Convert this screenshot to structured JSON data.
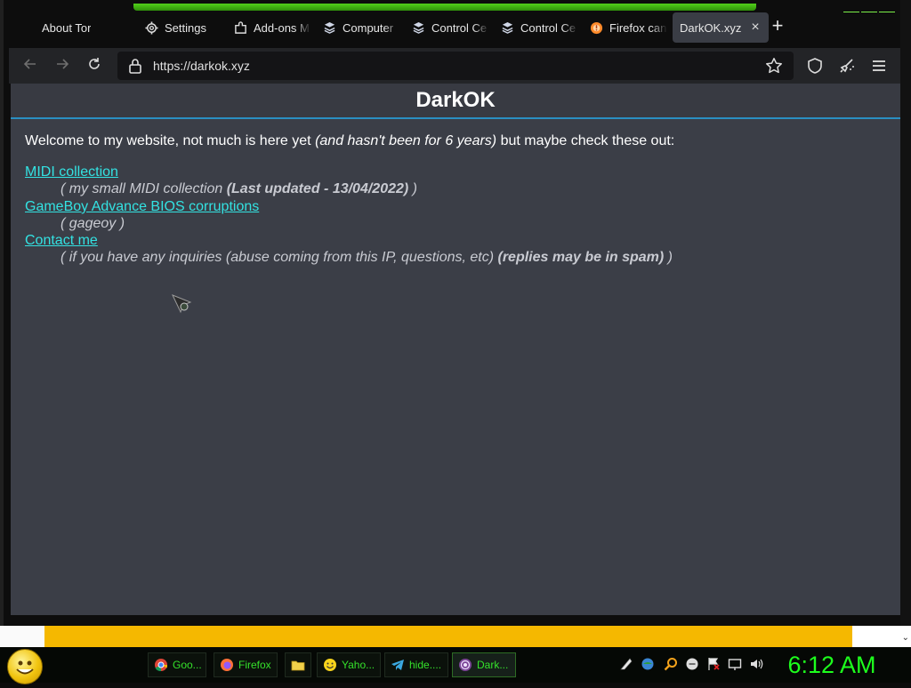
{
  "browser": {
    "tabs": [
      {
        "label": "About Tor",
        "icon": "tor-onion-icon"
      },
      {
        "label": "Settings",
        "icon": "gear-icon"
      },
      {
        "label": "Add-ons M",
        "icon": "puzzle-icon"
      },
      {
        "label": "Computer",
        "icon": "stack-icon"
      },
      {
        "label": "Control Ce",
        "icon": "stack-icon"
      },
      {
        "label": "Control Ce",
        "icon": "stack-icon"
      },
      {
        "label": "Firefox can",
        "icon": "firefox-warning-icon"
      },
      {
        "label": "DarkOK.xyz",
        "icon": "none",
        "active": true
      }
    ],
    "new_tab_label": "+",
    "close_tab_label": "×",
    "url": "https://darkok.xyz"
  },
  "page": {
    "title": "DarkOK",
    "welcome_prefix": "Welcome to my website, not much is here yet ",
    "welcome_italic": "(and hasn't been for 6 years)",
    "welcome_suffix": " but maybe check these out:",
    "links": [
      {
        "label": "MIDI collection",
        "desc_prefix": "( my small MIDI collection ",
        "desc_bold": "(Last updated - 13/04/2022)",
        "desc_suffix": " )"
      },
      {
        "label": "GameBoy Advance BIOS corruptions",
        "desc_prefix": "( gageoy )",
        "desc_bold": "",
        "desc_suffix": ""
      },
      {
        "label": "Contact me",
        "desc_prefix": "( if you have any inquiries (abuse coming from this IP, questions, etc) ",
        "desc_bold": "(replies may be in spam)",
        "desc_suffix": " )"
      }
    ]
  },
  "taskbar": {
    "items": [
      {
        "label": "Goo...",
        "icon": "chrome-icon"
      },
      {
        "label": "Firefox",
        "icon": "firefox-icon"
      },
      {
        "label": "",
        "icon": "folder-icon"
      },
      {
        "label": "Yaho...",
        "icon": "yahoo-messenger-icon"
      },
      {
        "label": "hide....",
        "icon": "telegram-icon"
      },
      {
        "label": "Dark...",
        "icon": "tor-browser-icon",
        "active": true
      }
    ],
    "clock": "6:12 AM"
  },
  "colors": {
    "link": "#33e2e2",
    "header_rule": "#2a8fc2",
    "content_bg": "#3b3e47",
    "clock": "#1dff1d",
    "taskbar_text": "#35e12b"
  }
}
